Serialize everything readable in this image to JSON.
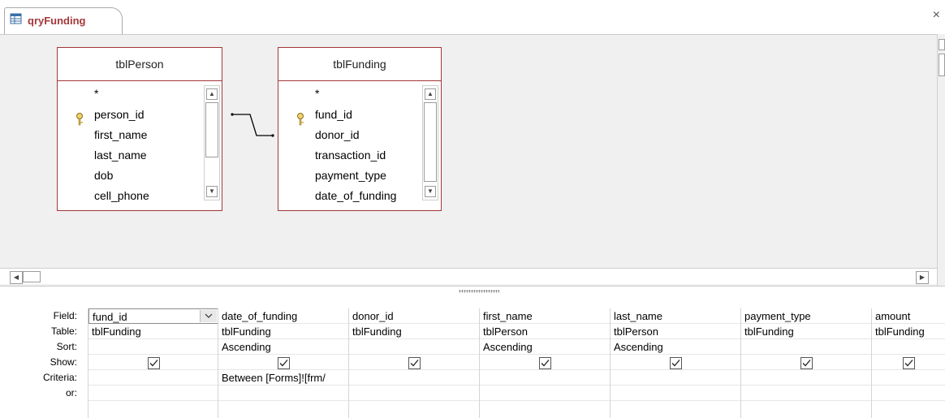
{
  "tab": {
    "title": "qryFunding",
    "close": "×"
  },
  "tables": {
    "person": {
      "title": "tblPerson",
      "fields": [
        "*",
        "person_id",
        "first_name",
        "last_name",
        "dob",
        "cell_phone"
      ]
    },
    "funding": {
      "title": "tblFunding",
      "fields": [
        "*",
        "fund_id",
        "donor_id",
        "transaction_id",
        "payment_type",
        "date_of_funding"
      ]
    }
  },
  "grid": {
    "row_labels": [
      "Field:",
      "Table:",
      "Sort:",
      "Show:",
      "Criteria:",
      "or:"
    ],
    "columns": [
      {
        "field": "fund_id",
        "table": "tblFunding",
        "sort": "",
        "show": true,
        "criteria": "",
        "or": ""
      },
      {
        "field": "date_of_funding",
        "table": "tblFunding",
        "sort": "Ascending",
        "show": true,
        "criteria": "Between [Forms]![frm/",
        "or": ""
      },
      {
        "field": "donor_id",
        "table": "tblFunding",
        "sort": "",
        "show": true,
        "criteria": "",
        "or": ""
      },
      {
        "field": "first_name",
        "table": "tblPerson",
        "sort": "Ascending",
        "show": true,
        "criteria": "",
        "or": ""
      },
      {
        "field": "last_name",
        "table": "tblPerson",
        "sort": "Ascending",
        "show": true,
        "criteria": "",
        "or": ""
      },
      {
        "field": "payment_type",
        "table": "tblFunding",
        "sort": "",
        "show": true,
        "criteria": "",
        "or": ""
      },
      {
        "field": "amount",
        "table": "tblFunding",
        "sort": "",
        "show": true,
        "criteria": "",
        "or": ""
      }
    ]
  },
  "colors": {
    "accent": "#a4373a",
    "pane": "#f0f0f0"
  }
}
